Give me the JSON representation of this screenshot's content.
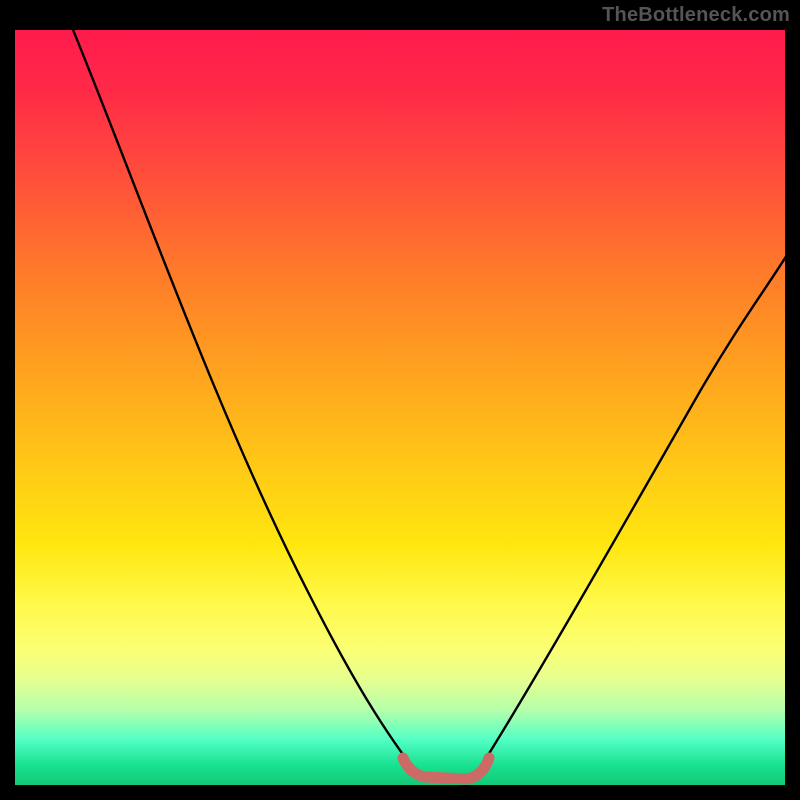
{
  "watermark": "TheBottleneck.com",
  "colors": {
    "page_background": "#000000",
    "curve_stroke": "#000000",
    "floor_stroke": "#cc6b66",
    "gradient_stops": [
      "#ff1a4d",
      "#ff2a47",
      "#ff4a3d",
      "#ff7a2a",
      "#ffa21f",
      "#ffc916",
      "#ffe60f",
      "#fff94a",
      "#fbff74",
      "#e6ff8f",
      "#b6ffab",
      "#52ffc5",
      "#17e08e",
      "#14c977"
    ]
  },
  "chart_data": {
    "type": "line",
    "title": "",
    "xlabel": "",
    "ylabel": "",
    "xlim": [
      0,
      100
    ],
    "ylim": [
      0,
      100
    ],
    "background": "red-yellow-green vertical gradient",
    "series": [
      {
        "name": "left-curve",
        "x": [
          7,
          12,
          18,
          24,
          30,
          36,
          42,
          47,
          51
        ],
        "y": [
          100,
          87,
          74,
          60,
          46,
          33,
          20,
          10,
          3
        ]
      },
      {
        "name": "floor-segment",
        "x": [
          51,
          53,
          55,
          57,
          59,
          61
        ],
        "y": [
          3,
          1,
          0.5,
          0.5,
          1,
          3
        ]
      },
      {
        "name": "right-curve",
        "x": [
          61,
          66,
          72,
          79,
          86,
          93,
          100
        ],
        "y": [
          3,
          10,
          20,
          32,
          45,
          58,
          70
        ]
      }
    ],
    "annotations": [
      {
        "text": "TheBottleneck.com",
        "position": "top-right"
      }
    ]
  }
}
